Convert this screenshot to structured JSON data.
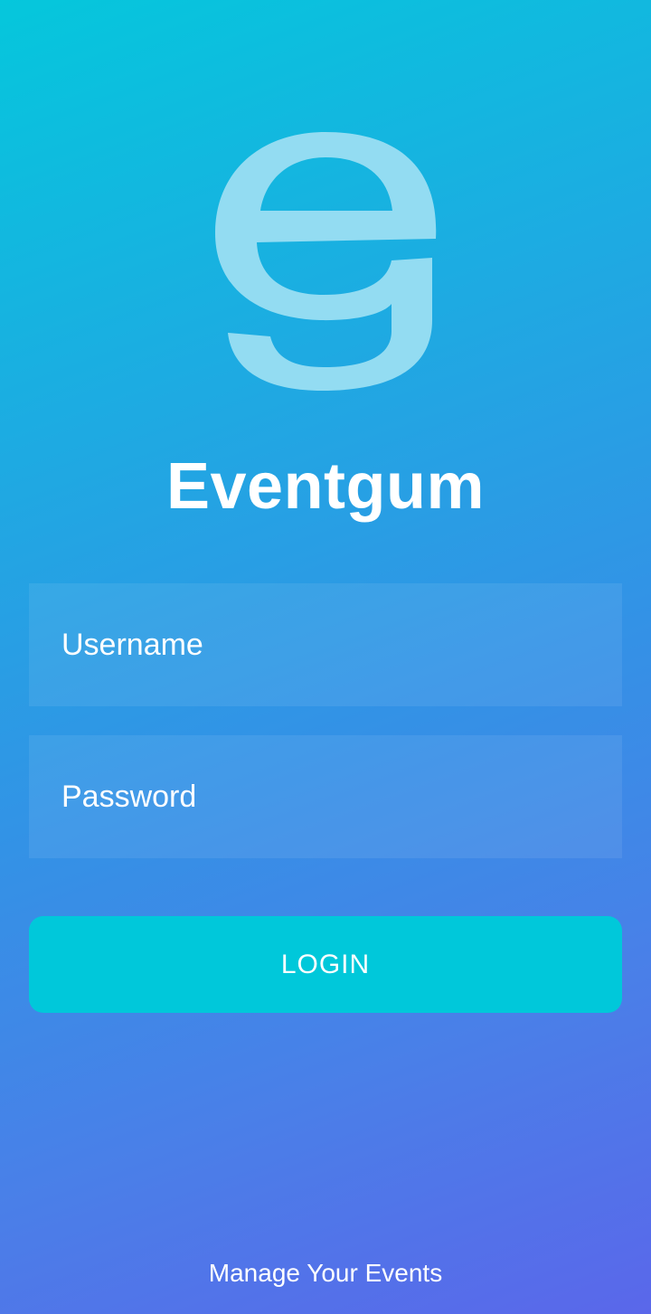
{
  "app": {
    "logo_icon": "eventgum-e-logo-icon",
    "logo_color": "#93dcf2",
    "title": "Eventgum",
    "tagline": "Manage Your Events"
  },
  "login_form": {
    "username": {
      "placeholder": "Username",
      "value": ""
    },
    "password": {
      "placeholder": "Password",
      "value": ""
    },
    "submit_label": "LOGIN"
  },
  "colors": {
    "gradient_start": "#05c7dc",
    "gradient_end": "#5a67ea",
    "button": "#00c8da",
    "text": "#ffffff"
  }
}
